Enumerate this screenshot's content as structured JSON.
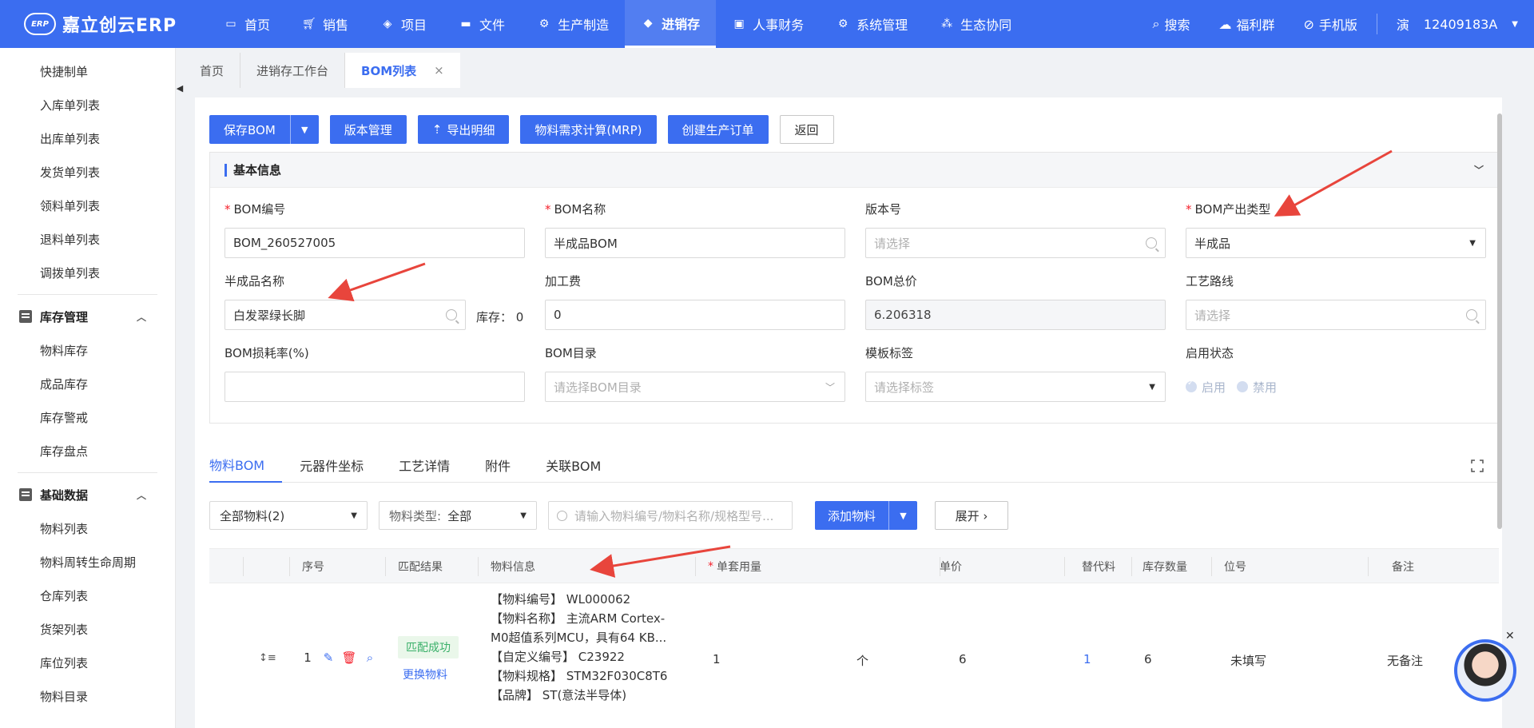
{
  "app": {
    "logo_badge": "ERP",
    "logo_text": "嘉立创云ERP"
  },
  "nav": [
    {
      "label": "首页",
      "icon": "monitor-icon"
    },
    {
      "label": "销售",
      "icon": "cart-icon"
    },
    {
      "label": "项目",
      "icon": "layers-icon"
    },
    {
      "label": "文件",
      "icon": "folder-icon"
    },
    {
      "label": "生产制造",
      "icon": "gear-icon"
    },
    {
      "label": "进销存",
      "icon": "box-icon",
      "active": true
    },
    {
      "label": "人事财务",
      "icon": "bookmark-icon"
    },
    {
      "label": "系统管理",
      "icon": "cog-icon"
    },
    {
      "label": "生态协同",
      "icon": "cluster-icon"
    }
  ],
  "top_right": {
    "search": "搜索",
    "welfare": "福利群",
    "mobile": "手机版",
    "user_badge": "演",
    "user_id": "12409183A"
  },
  "sidebar": {
    "items_top": [
      "快捷制单",
      "入库单列表",
      "出库单列表",
      "发货单列表",
      "领料单列表",
      "退料单列表",
      "调拨单列表"
    ],
    "group1": {
      "label": "库存管理",
      "items": [
        "物料库存",
        "成品库存",
        "库存警戒",
        "库存盘点"
      ]
    },
    "group2": {
      "label": "基础数据",
      "items": [
        "物料列表",
        "物料周转生命周期",
        "仓库列表",
        "货架列表",
        "库位列表",
        "物料目录"
      ]
    }
  },
  "page_tabs": [
    {
      "label": "首页"
    },
    {
      "label": "进销存工作台"
    },
    {
      "label": "BOM列表",
      "active": true,
      "close": "×"
    }
  ],
  "toolbar": {
    "save": "保存BOM",
    "dropdown": "⌄",
    "version": "版本管理",
    "export": "导出明细",
    "mrp": "物料需求计算(MRP)",
    "create_order": "创建生产订单",
    "back": "返回"
  },
  "basic_info": {
    "title": "基本信息",
    "bom_no": {
      "label": "BOM编号",
      "value": "BOM_260527005"
    },
    "bom_name": {
      "label": "BOM名称",
      "value": "半成品BOM"
    },
    "version_no": {
      "label": "版本号",
      "placeholder": "请选择"
    },
    "output_type": {
      "label": "BOM产出类型",
      "value": "半成品"
    },
    "semi_name": {
      "label": "半成品名称",
      "value": "白发翠绿长脚"
    },
    "stock": "库存：  0",
    "process_fee": {
      "label": "加工费",
      "value": "0"
    },
    "total_price": {
      "label": "BOM总价",
      "value": "6.206318"
    },
    "route": {
      "label": "工艺路线",
      "placeholder": "请选择"
    },
    "loss_rate": {
      "label": "BOM损耗率(%)",
      "value": ""
    },
    "catalog": {
      "label": "BOM目录",
      "placeholder": "请选择BOM目录"
    },
    "template_tag": {
      "label": "模板标签",
      "placeholder": "请选择标签"
    },
    "status": {
      "label": "启用状态",
      "on": "启用",
      "off": "禁用"
    }
  },
  "sub_tabs": [
    "物料BOM",
    "元器件坐标",
    "工艺详情",
    "附件",
    "关联BOM"
  ],
  "filters": {
    "material_scope": "全部物料(2)",
    "type_label": "物料类型:",
    "type_value": "全部",
    "search_placeholder": "请输入物料编号/物料名称/规格型号...",
    "add_material": "添加物料",
    "expand": "展开 ›"
  },
  "table": {
    "headers": {
      "seq": "序号",
      "match": "匹配结果",
      "info": "物料信息",
      "qty": "单套用量",
      "unit": "单价",
      "alt": "替代料",
      "stock": "库存数量",
      "position": "位号",
      "note": "备注"
    },
    "rows": [
      {
        "seq": "1",
        "match": "匹配成功",
        "replace": "更换物料",
        "info_lines": [
          "【物料编号】 WL000062",
          "【物料名称】 主流ARM Cortex-",
          "M0超值系列MCU，具有64 KB...",
          "【自定义编号】 C23922",
          "【物料规格】 STM32F030C8T6",
          "【品牌】 ST(意法半导体)"
        ],
        "qty": "1",
        "unit": "个",
        "price": "6",
        "alt": "1",
        "stock": "6",
        "position": "未填写",
        "note": "无备注"
      }
    ]
  },
  "colors": {
    "primary": "#3b6df0",
    "success_bg": "#eaf7ea",
    "success_text": "#3bb06a",
    "danger": "#f5222d",
    "arrow": "#e8453c"
  }
}
